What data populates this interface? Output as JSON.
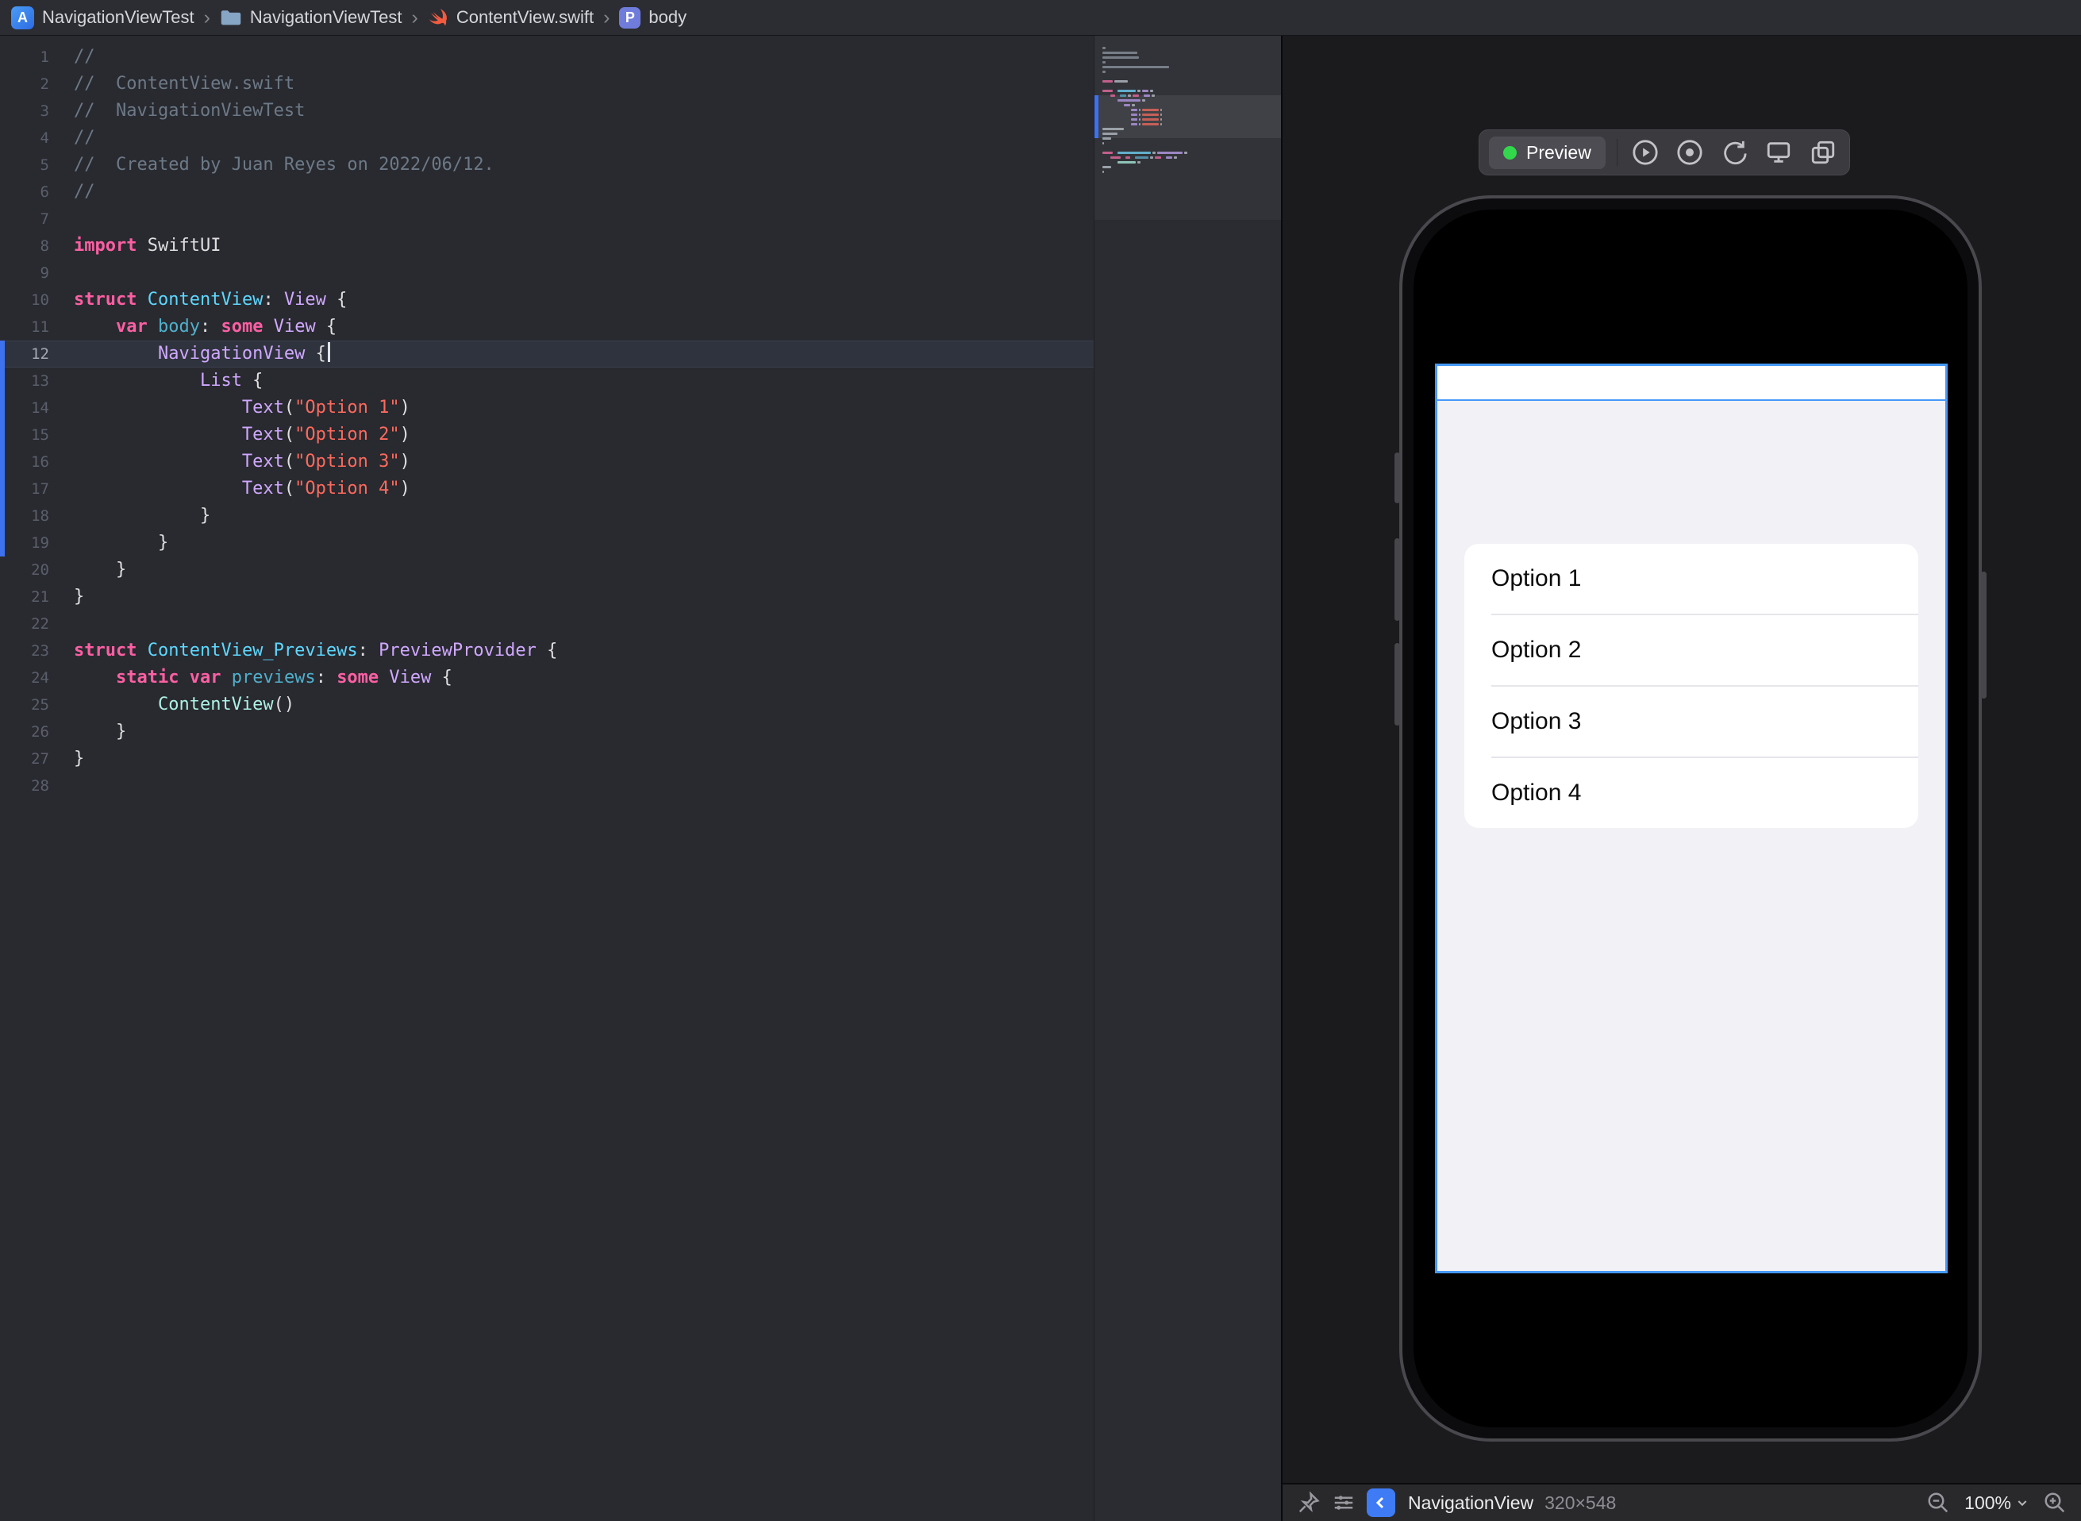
{
  "jump_bar": {
    "app_badge": "A",
    "project": "NavigationViewTest",
    "group": "NavigationViewTest",
    "file": "ContentView.swift",
    "symbol_badge": "P",
    "symbol": "body"
  },
  "editor": {
    "current_line": 12,
    "change_bar_lines": [
      12,
      19
    ],
    "lines": [
      {
        "n": 1,
        "t": [
          [
            "com",
            "//"
          ]
        ]
      },
      {
        "n": 2,
        "t": [
          [
            "com",
            "//  ContentView.swift"
          ]
        ]
      },
      {
        "n": 3,
        "t": [
          [
            "com",
            "//  NavigationViewTest"
          ]
        ]
      },
      {
        "n": 4,
        "t": [
          [
            "com",
            "//"
          ]
        ]
      },
      {
        "n": 5,
        "t": [
          [
            "com",
            "//  Created by Juan Reyes on 2022/06/12."
          ]
        ]
      },
      {
        "n": 6,
        "t": [
          [
            "com",
            "//"
          ]
        ]
      },
      {
        "n": 7,
        "t": []
      },
      {
        "n": 8,
        "t": [
          [
            "kw",
            "import"
          ],
          [
            "pln",
            " SwiftUI"
          ]
        ]
      },
      {
        "n": 9,
        "t": []
      },
      {
        "n": 10,
        "t": [
          [
            "kw",
            "struct"
          ],
          [
            "pln",
            " "
          ],
          [
            "decl",
            "ContentView"
          ],
          [
            "pln",
            ": "
          ],
          [
            "typ",
            "View"
          ],
          [
            "pln",
            " {"
          ]
        ]
      },
      {
        "n": 11,
        "t": [
          [
            "pln",
            "    "
          ],
          [
            "kw",
            "var"
          ],
          [
            "pln",
            " "
          ],
          [
            "prop",
            "body"
          ],
          [
            "pln",
            ": "
          ],
          [
            "kw",
            "some"
          ],
          [
            "pln",
            " "
          ],
          [
            "typ",
            "View"
          ],
          [
            "pln",
            " {"
          ]
        ]
      },
      {
        "n": 12,
        "t": [
          [
            "pln",
            "        "
          ],
          [
            "typ",
            "NavigationView"
          ],
          [
            "pln",
            " {"
          ]
        ]
      },
      {
        "n": 13,
        "t": [
          [
            "pln",
            "            "
          ],
          [
            "typ",
            "List"
          ],
          [
            "pln",
            " {"
          ]
        ]
      },
      {
        "n": 14,
        "t": [
          [
            "pln",
            "                "
          ],
          [
            "typ",
            "Text"
          ],
          [
            "pln",
            "("
          ],
          [
            "str",
            "\"Option 1\""
          ],
          [
            "pln",
            ")"
          ]
        ]
      },
      {
        "n": 15,
        "t": [
          [
            "pln",
            "                "
          ],
          [
            "typ",
            "Text"
          ],
          [
            "pln",
            "("
          ],
          [
            "str",
            "\"Option 2\""
          ],
          [
            "pln",
            ")"
          ]
        ]
      },
      {
        "n": 16,
        "t": [
          [
            "pln",
            "                "
          ],
          [
            "typ",
            "Text"
          ],
          [
            "pln",
            "("
          ],
          [
            "str",
            "\"Option 3\""
          ],
          [
            "pln",
            ")"
          ]
        ]
      },
      {
        "n": 17,
        "t": [
          [
            "pln",
            "                "
          ],
          [
            "typ",
            "Text"
          ],
          [
            "pln",
            "("
          ],
          [
            "str",
            "\"Option 4\""
          ],
          [
            "pln",
            ")"
          ]
        ]
      },
      {
        "n": 18,
        "t": [
          [
            "pln",
            "            }"
          ]
        ]
      },
      {
        "n": 19,
        "t": [
          [
            "pln",
            "        }"
          ]
        ]
      },
      {
        "n": 20,
        "t": [
          [
            "pln",
            "    }"
          ]
        ]
      },
      {
        "n": 21,
        "t": [
          [
            "pln",
            "}"
          ]
        ]
      },
      {
        "n": 22,
        "t": []
      },
      {
        "n": 23,
        "t": [
          [
            "kw",
            "struct"
          ],
          [
            "pln",
            " "
          ],
          [
            "decl",
            "ContentView_Previews"
          ],
          [
            "pln",
            ": "
          ],
          [
            "typ",
            "PreviewProvider"
          ],
          [
            "pln",
            " {"
          ]
        ]
      },
      {
        "n": 24,
        "t": [
          [
            "pln",
            "    "
          ],
          [
            "kw",
            "static"
          ],
          [
            "pln",
            " "
          ],
          [
            "kw",
            "var"
          ],
          [
            "pln",
            " "
          ],
          [
            "prop",
            "previews"
          ],
          [
            "pln",
            ": "
          ],
          [
            "kw",
            "some"
          ],
          [
            "pln",
            " "
          ],
          [
            "typ",
            "View"
          ],
          [
            "pln",
            " {"
          ]
        ]
      },
      {
        "n": 25,
        "t": [
          [
            "pln",
            "        "
          ],
          [
            "ref",
            "ContentView"
          ],
          [
            "pln",
            "()"
          ]
        ]
      },
      {
        "n": 26,
        "t": [
          [
            "pln",
            "    }"
          ]
        ]
      },
      {
        "n": 27,
        "t": [
          [
            "pln",
            "}"
          ]
        ]
      },
      {
        "n": 28,
        "t": []
      }
    ]
  },
  "preview": {
    "toolbar": {
      "label": "Preview",
      "status_color": "#32D74B",
      "icons": [
        "play-circle-icon",
        "inspect-icon",
        "rotate-icon",
        "display-icon",
        "duplicate-icon"
      ]
    },
    "list_items": [
      "Option 1",
      "Option 2",
      "Option 3",
      "Option 4"
    ],
    "selection_color": "#4699F7"
  },
  "status_bar": {
    "icons": [
      "pin-icon",
      "adjust-icon",
      "back-chevron-icon"
    ],
    "selection": "NavigationView",
    "size": "320×548",
    "zoom": "100%",
    "zoom_icons": [
      "zoom-out-icon",
      "zoom-in-icon"
    ]
  },
  "colors": {
    "keyword": "#FC5FA3",
    "string": "#FC6A5D",
    "comment": "#6C7986",
    "framework_type": "#D0A8FF",
    "type_declaration": "#5DD8FF",
    "property_declaration": "#4FB0CC",
    "project_reference": "#ACF2E4",
    "plain_text": "#DFDFE0",
    "editor_background": "#292A30",
    "accent_blue": "#3E71EE"
  }
}
